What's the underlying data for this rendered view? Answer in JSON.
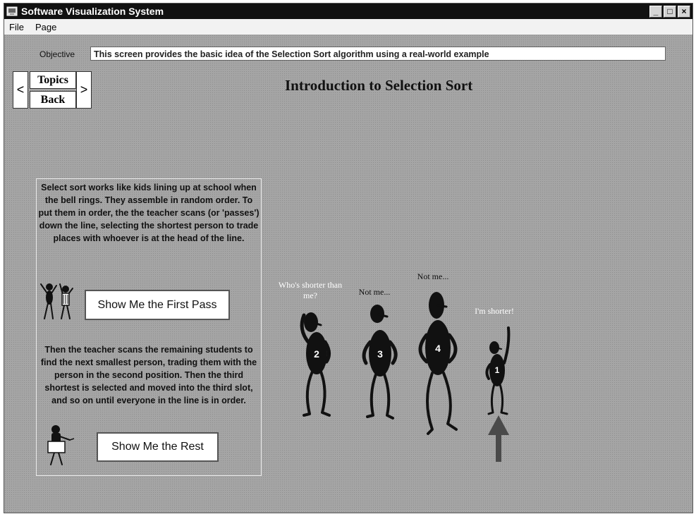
{
  "window": {
    "title": "Software Visualization System",
    "min_symbol": "_",
    "max_symbol": "□",
    "close_symbol": "×"
  },
  "menu": {
    "file": "File",
    "page": "Page"
  },
  "objective": {
    "label": "Objective",
    "text": "This screen provides the basic idea of the Selection Sort algorithm using a real-world example"
  },
  "nav": {
    "prev_symbol": "<",
    "next_symbol": ">",
    "topics_label": "Topics",
    "back_label": "Back"
  },
  "page_title": "Introduction to Selection Sort",
  "panel": {
    "paragraph1": "Select sort works like kids lining up at school when the bell rings.  They assemble in random order.  To put them in order,  the the teacher scans (or 'passes')  down the line, selecting the shortest person to trade places with whoever is at the head of the line.",
    "first_pass_button": "Show Me the First Pass",
    "paragraph2": "Then the teacher scans the remaining students to find the next smallest person, trading them with the person in the second position.  Then the third shortest is selected and moved into the third slot, and so on until everyone in the line is in order.",
    "rest_button": "Show Me the Rest"
  },
  "figures": [
    {
      "number": "2",
      "caption": "Who's shorter than me?",
      "caption_color": "#ffffff"
    },
    {
      "number": "3",
      "caption": "Not me...",
      "caption_color": "#111111"
    },
    {
      "number": "4",
      "caption": "Not me...",
      "caption_color": "#111111"
    },
    {
      "number": "1",
      "caption": "I'm shorter!",
      "caption_color": "#ffffff"
    }
  ],
  "colors": {
    "background": "#a5a5a5",
    "figure_fill": "#111111",
    "arrow": "#4a4a4a"
  }
}
